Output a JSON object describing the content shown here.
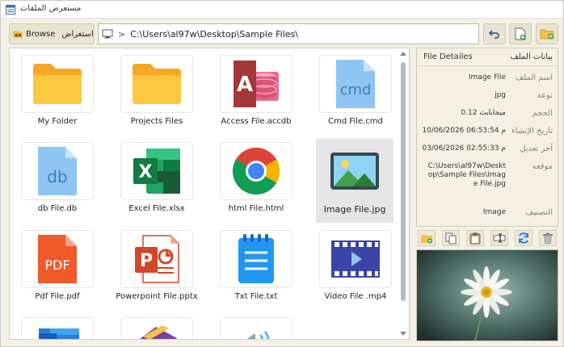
{
  "window": {
    "title": "مستعرض الملفات"
  },
  "toolbar": {
    "browse_en": "Browse",
    "browse_ar": "استعراض",
    "path_separator": ">",
    "path": "C:\\Users\\al97w\\Desktop\\Sample Files\\"
  },
  "files": [
    {
      "name": "My Folder",
      "icon": "folder-icon"
    },
    {
      "name": "Projects Files",
      "icon": "folder-icon"
    },
    {
      "name": "Access File.accdb",
      "icon": "access-icon"
    },
    {
      "name": "Cmd File.cmd",
      "icon": "cmd-file-icon"
    },
    {
      "name": "db File.db",
      "icon": "db-file-icon"
    },
    {
      "name": "Excel File.xlsx",
      "icon": "excel-icon"
    },
    {
      "name": "html File.html",
      "icon": "chrome-icon"
    },
    {
      "name": "Image File.jpg",
      "icon": "image-icon"
    },
    {
      "name": "Pdf File.pdf",
      "icon": "pdf-icon"
    },
    {
      "name": "Powerpoint File.pptx",
      "icon": "powerpoint-icon"
    },
    {
      "name": "Txt File.txt",
      "icon": "notepad-icon"
    },
    {
      "name": "Video File .mp4",
      "icon": "video-icon"
    }
  ],
  "selected_file": "Image File.jpg",
  "details": {
    "header_en": "File Detailes",
    "header_ar": "بيانات الملف",
    "rows": [
      {
        "label": "اسم الملف",
        "value": "Image File"
      },
      {
        "label": "نوعه",
        "value": "jpg"
      },
      {
        "label": "الحجم",
        "value": "0.12 ميجابايت"
      },
      {
        "label": "تاريخ الإنشاء",
        "value": "10/06/2026 06:53:54 م"
      },
      {
        "label": "آخر تعديل",
        "value": "03/06/2026 02:55:33 م"
      },
      {
        "label": "موقعه",
        "value": "C:\\Users\\al97w\\Desktop\\Sample Files\\Image File.jpg"
      },
      {
        "label": "التصنيف",
        "value": "Image"
      }
    ]
  },
  "colors": {
    "accent_folder": "#F9C840",
    "access": "#A4373A",
    "excel": "#1D7044",
    "pdf": "#F0592A",
    "powerpoint": "#D24726",
    "video": "#3B45A7",
    "file_blue": "#8EC5F2",
    "window_bg": "#F4F1E4"
  }
}
